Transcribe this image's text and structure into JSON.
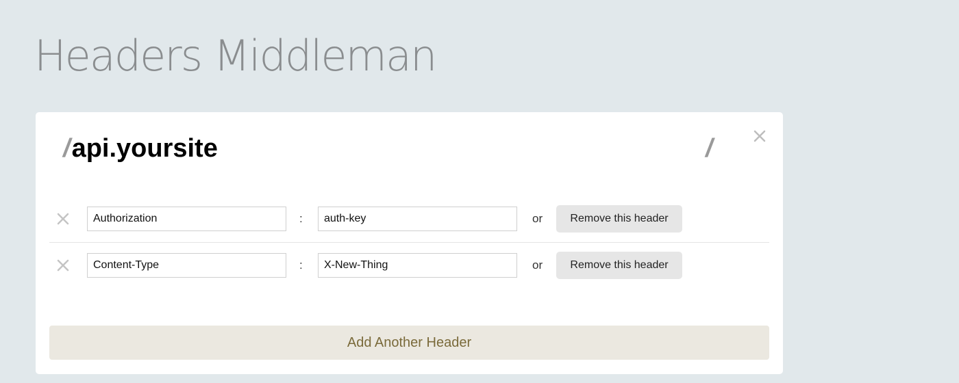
{
  "app": {
    "title": "Headers Middleman"
  },
  "route": {
    "prefix_slash": "/",
    "host": "api.yoursite",
    "suffix_slash": "/"
  },
  "icons": {
    "close": "close-icon",
    "remove_row": "x-icon"
  },
  "headers": [
    {
      "name": "Authorization",
      "separator": ":",
      "value": "auth-key",
      "or_label": "or",
      "remove_label": "Remove this header"
    },
    {
      "name": "Content-Type",
      "separator": ":",
      "value": "X-New-Thing",
      "or_label": "or",
      "remove_label": "Remove this header"
    }
  ],
  "add_button": {
    "label": "Add Another Header"
  },
  "colors": {
    "background": "#e1e8eb",
    "card": "#ffffff",
    "add_button_bg": "#ebe8e0",
    "add_button_text": "#7a6a3a",
    "remove_button_bg": "#e6e6e6"
  }
}
